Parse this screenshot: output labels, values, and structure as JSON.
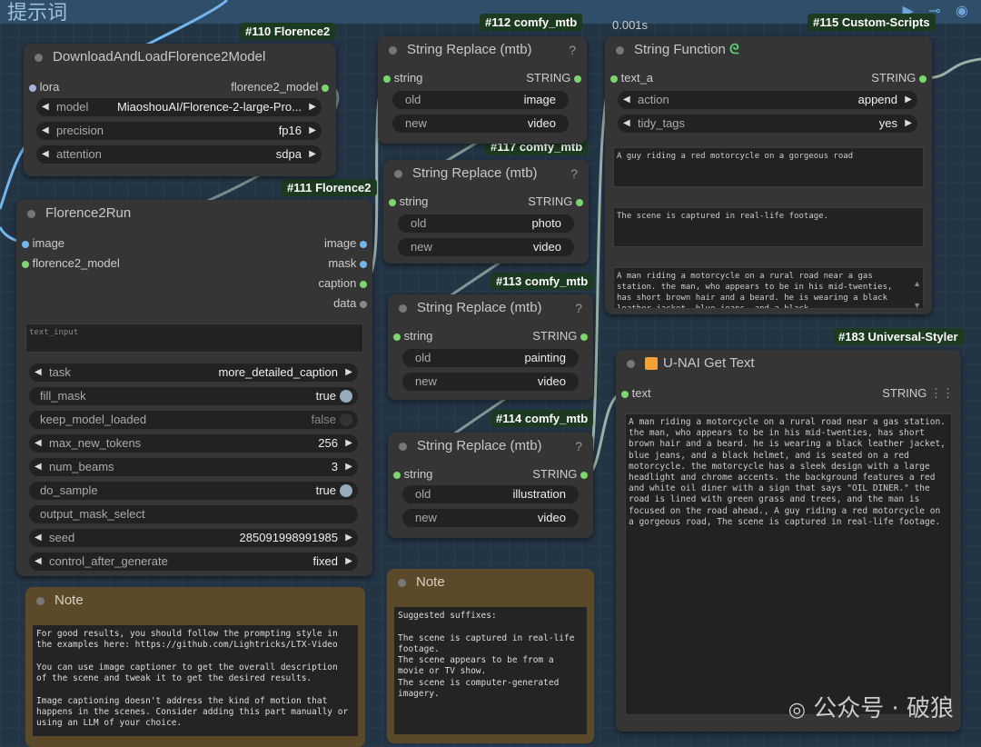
{
  "group": {
    "title": "提示词"
  },
  "badges": {
    "florence2": "#110 Florence2",
    "comfy112": "#112 comfy_mtb",
    "custom115": "#115 Custom-Scripts",
    "florence111": "#111 Florence2",
    "comfy117": "#117 comfy_mtb",
    "comfy113": "#113 comfy_mtb",
    "comfy114": "#114 comfy_mtb",
    "styler183": "#183 Universal-Styler"
  },
  "timing": "0.001s",
  "download_node": {
    "title": "DownloadAndLoadFlorence2Model",
    "input_lora": "lora",
    "output_model": "florence2_model",
    "widgets": [
      {
        "label": "model",
        "value": "MiaoshouAI/Florence-2-large-Pro..."
      },
      {
        "label": "precision",
        "value": "fp16"
      },
      {
        "label": "attention",
        "value": "sdpa"
      }
    ]
  },
  "run_node": {
    "title": "Florence2Run",
    "inputs": [
      "image",
      "florence2_model"
    ],
    "outputs": [
      "image",
      "mask",
      "caption",
      "data"
    ],
    "text_input_placeholder": "text_input",
    "widgets": [
      {
        "label": "task",
        "value": "more_detailed_caption"
      },
      {
        "label": "fill_mask",
        "value": "true"
      },
      {
        "label": "keep_model_loaded",
        "value": "false"
      },
      {
        "label": "max_new_tokens",
        "value": "256"
      },
      {
        "label": "num_beams",
        "value": "3"
      },
      {
        "label": "do_sample",
        "value": "true"
      },
      {
        "label": "output_mask_select",
        "value": ""
      },
      {
        "label": "seed",
        "value": "285091998991985"
      },
      {
        "label": "control_after_generate",
        "value": "fixed"
      }
    ]
  },
  "replace_nodes": [
    {
      "title": "String Replace (mtb)",
      "input": "string",
      "output": "STRING",
      "old": "image",
      "new": "video",
      "old_label": "old",
      "new_label": "new",
      "q": "?"
    },
    {
      "title": "String Replace (mtb)",
      "input": "string",
      "output": "STRING",
      "old": "photo",
      "new": "video",
      "old_label": "old",
      "new_label": "new",
      "q": "?"
    },
    {
      "title": "String Replace (mtb)",
      "input": "string",
      "output": "STRING",
      "old": "painting",
      "new": "video",
      "old_label": "old",
      "new_label": "new",
      "q": "?"
    },
    {
      "title": "String Replace (mtb)",
      "input": "string",
      "output": "STRING",
      "old": "illustration",
      "new": "video",
      "old_label": "old",
      "new_label": "new",
      "q": "?"
    }
  ],
  "string_function": {
    "title": "String Function",
    "input": "text_a",
    "output": "STRING",
    "widgets": [
      {
        "label": "action",
        "value": "append"
      },
      {
        "label": "tidy_tags",
        "value": "yes"
      }
    ],
    "text_b": "A guy riding a red motorcycle on a gorgeous road",
    "text_c": "The scene is captured in real-life footage.",
    "result": "A man riding a motorcycle on a rural road near a gas station. the man, who appears to be in his mid-twenties, has short brown hair and a beard. he is wearing a black leather jacket, blue jeans, and a black"
  },
  "get_text": {
    "title": "U-NAI Get Text",
    "input": "text",
    "output": "STRING",
    "content": "A man riding a motorcycle on a rural road near a gas station. the man, who appears to be in his mid-twenties, has short brown hair and a beard. he is wearing a black leather jacket, blue jeans, and a black helmet, and is seated on a red motorcycle. the motorcycle has a sleek design with a large headlight and chrome accents. the background features a red and white oil diner with a sign that says \"OIL DINER.\" the road is lined with green grass and trees, and the man is focused on the road ahead., A guy riding a red motorcycle on a gorgeous road, The scene is captured in real-life footage."
  },
  "note1": {
    "title": "Note",
    "text": "For good results, you should follow the prompting style in\nthe examples here: https://github.com/Lightricks/LTX-Video\n\nYou can use image captioner to get the overall description\nof the scene and tweak it to get the desired results.\n\nImage captioning doesn't address the kind of motion that\nhappens in the scenes. Consider adding this part manually or\nusing an LLM of your choice."
  },
  "note2": {
    "title": "Note",
    "text": "Suggested suffixes:\n\nThe scene is captured in real-life\nfootage.\nThe scene appears to be from a\nmovie or TV show.\nThe scene is computer-generated\nimagery."
  },
  "watermark": "公众号 · 破狼"
}
